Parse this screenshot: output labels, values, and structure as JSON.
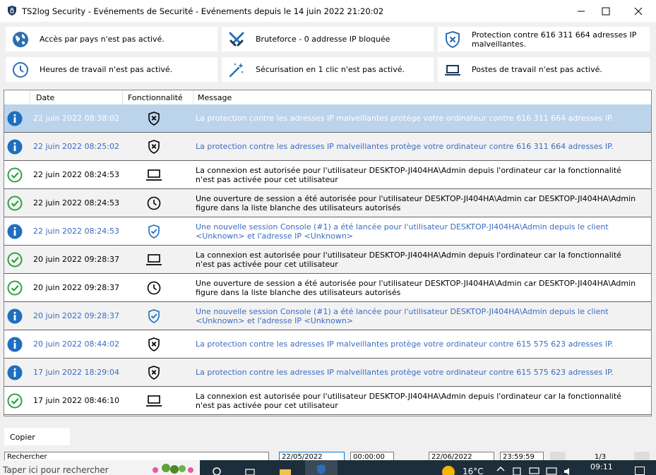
{
  "window": {
    "title": "TS2log Security - Evénements de Securité - Evénements depuis le 14 juin 2022 21:20:02"
  },
  "tiles": [
    {
      "icon": "globe-icon",
      "label": "Accès par pays n'est pas activé."
    },
    {
      "icon": "crossed-swords-icon",
      "label": "Bruteforce - 0 addresse IP bloquée"
    },
    {
      "icon": "shield-x-icon",
      "label": "Protection contre 616 311 664 adresses IP malveillantes."
    },
    {
      "icon": "clock-icon",
      "label": "Heures de travail n'est pas activé."
    },
    {
      "icon": "magic-wand-icon",
      "label": "Sécurisation en 1 clic n'est pas activé."
    },
    {
      "icon": "laptop-icon",
      "label": "Postes de travail n'est pas activé."
    }
  ],
  "grid": {
    "columns": {
      "date": "Date",
      "feature": "Fonctionnalité",
      "message": "Message"
    },
    "rows": [
      {
        "status": "info",
        "date": "22 juin 2022 08:38:02",
        "feature": "shield-x",
        "message": "La protection contre les adresses IP malveillantes protège votre ordinateur contre 616 311 664 adresses IP."
      },
      {
        "status": "info",
        "date": "22 juin 2022 08:25:02",
        "feature": "shield-x",
        "message": "La protection contre les adresses IP malveillantes protège votre ordinateur contre 616 311 664 adresses IP."
      },
      {
        "status": "ok",
        "date": "22 juin 2022 08:24:53",
        "feature": "laptop",
        "message": "La connexion est autorisée pour l'utilisateur DESKTOP-JI404HA\\Admin depuis l'ordinateur  car la fonctionnalité n'est pas activée pour cet utilisateur"
      },
      {
        "status": "ok",
        "date": "22 juin 2022 08:24:53",
        "feature": "clock",
        "message": "Une ouverture de session a été autorisée pour l'utilisateur DESKTOP-JI404HA\\Admin car DESKTOP-JI404HA\\Admin figure dans la liste blanche des utilisateurs autorisés"
      },
      {
        "status": "info",
        "date": "22 juin 2022 08:24:53",
        "feature": "shield-check",
        "message": "Une nouvelle session Console (#1) a été lancée pour l'utilisateur DESKTOP-JI404HA\\Admin depuis le client <Unknown> et l'adresse IP <Unknown>"
      },
      {
        "status": "ok",
        "date": "20 juin 2022 09:28:37",
        "feature": "laptop",
        "message": "La connexion est autorisée pour l'utilisateur DESKTOP-JI404HA\\Admin depuis l'ordinateur  car la fonctionnalité n'est pas activée pour cet utilisateur"
      },
      {
        "status": "ok",
        "date": "20 juin 2022 09:28:37",
        "feature": "clock",
        "message": "Une ouverture de session a été autorisée pour l'utilisateur DESKTOP-JI404HA\\Admin car DESKTOP-JI404HA\\Admin figure dans la liste blanche des utilisateurs autorisés"
      },
      {
        "status": "info",
        "date": "20 juin 2022 09:28:37",
        "feature": "shield-check",
        "message": "Une nouvelle session Console (#1) a été lancée pour l'utilisateur DESKTOP-JI404HA\\Admin depuis le client <Unknown> et l'adresse IP <Unknown>"
      },
      {
        "status": "info",
        "date": "20 juin 2022 08:44:02",
        "feature": "shield-x",
        "message": "La protection contre les adresses IP malveillantes protège votre ordinateur contre 615 575 623 adresses IP."
      },
      {
        "status": "info",
        "date": "17 juin 2022 18:29:04",
        "feature": "shield-x",
        "message": "La protection contre les adresses IP malveillantes protège votre ordinateur contre 615 575 623 adresses IP."
      },
      {
        "status": "ok",
        "date": "17 juin 2022 08:46:10",
        "feature": "laptop",
        "message": "La connexion est autorisée pour l'utilisateur DESKTOP-JI404HA\\Admin depuis l'ordinateur  car la fonctionnalité n'est pas activée pour cet utilisateur"
      }
    ],
    "selected_row": 0
  },
  "actions": {
    "copy": "Copier"
  },
  "filter": {
    "search_placeholder": "Rechercher",
    "date_from": "22/05/2022",
    "time_from": "00:00:00",
    "date_to": "22/06/2022",
    "time_to": "23:59:59",
    "page": "1/3"
  },
  "taskbar": {
    "search_text": "Taper ici pour rechercher",
    "temperature": "16°C",
    "time": "09:11"
  },
  "colors": {
    "info": "#1e6fbf",
    "ok": "#2ea043",
    "info_text": "#3b6bc1",
    "selected_row": "#bcd3ec"
  }
}
